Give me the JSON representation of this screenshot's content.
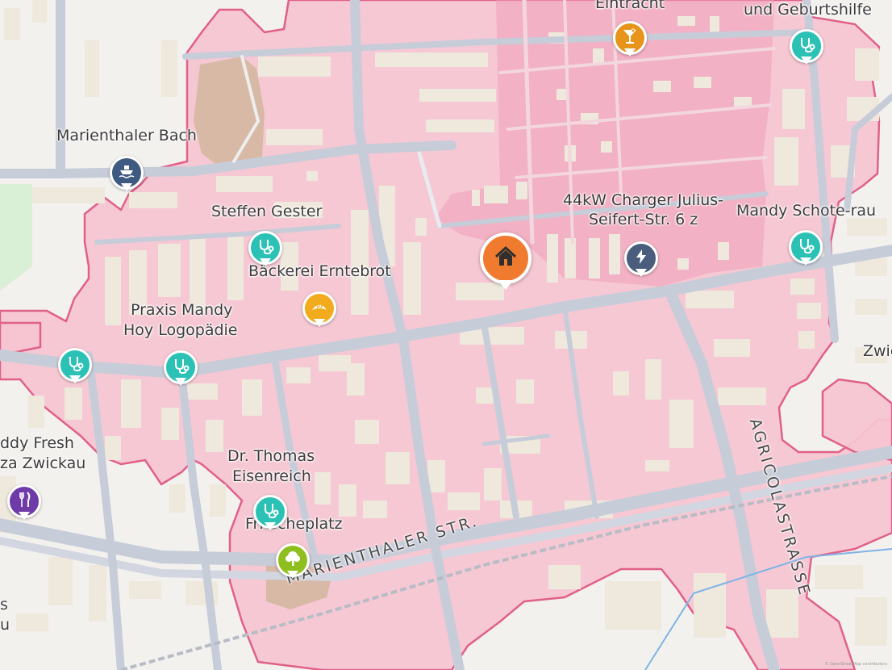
{
  "map": {
    "colors": {
      "zone_fill": "#f6c4d1",
      "zone_border": "#e0608a",
      "road": "#c7ccd9",
      "building": "#efe8dc",
      "background": "#f3f1ee",
      "park": "#d9efd6",
      "plaza": "#d7b9a6"
    },
    "labels": {
      "eintracht": "Eintracht",
      "geburtshilfe": "und Geburtshilfe",
      "marienthaler_bach": "Marienthaler Bach",
      "steffen_gester": "Steffen Gester",
      "baeckerei": "Bäckerei Erntebrot",
      "charger_line1": "44kW Charger Julius-",
      "charger_line2": "Seifert-Str. 6 z",
      "mandy_schote": "Mandy Schote-rau",
      "praxis_line1": "Praxis Mandy",
      "praxis_line2": "Hoy Logopädie",
      "zwi": "Zwic",
      "daddy_line1": "ddy Fresh",
      "daddy_line2": "za Zwickau",
      "thomas_line1": "Dr. Thomas",
      "thomas_line2": "Eisenreich",
      "fritscheplatz": "Fritscheplatz",
      "left_edge_1": "s",
      "left_edge_2": "u"
    },
    "streets": {
      "marienthaler": "MARIENTHALER STR.",
      "agricola": "AGRICOLASTRASSE"
    },
    "markers": [
      {
        "name": "bar",
        "icon": "cocktail-icon",
        "color": "#e8941a"
      },
      {
        "name": "geburtshilfe",
        "icon": "stethoscope-icon",
        "color": "#2bc1b5"
      },
      {
        "name": "marienthaler-bach",
        "icon": "boat-icon",
        "color": "#3e5a80"
      },
      {
        "name": "steffen-gester",
        "icon": "stethoscope-icon",
        "color": "#2bc1b5"
      },
      {
        "name": "baeckerei",
        "icon": "croissant-icon",
        "color": "#f3ab1e"
      },
      {
        "name": "charger",
        "icon": "lightning-icon",
        "color": "#4a5d7c"
      },
      {
        "name": "mandy-schote",
        "icon": "stethoscope-icon",
        "color": "#2bc1b5"
      },
      {
        "name": "praxis-left",
        "icon": "stethoscope-icon",
        "color": "#2bc1b5"
      },
      {
        "name": "praxis-mandy",
        "icon": "stethoscope-icon",
        "color": "#2bc1b5"
      },
      {
        "name": "restaurant",
        "icon": "fork-knife-icon",
        "color": "#6e3ba8"
      },
      {
        "name": "thomas-eisenreich",
        "icon": "stethoscope-icon",
        "color": "#2bc1b5"
      },
      {
        "name": "fritscheplatz",
        "icon": "tree-icon",
        "color": "#8fbf1e"
      },
      {
        "name": "home",
        "icon": "home-icon",
        "color": "#f07b2e"
      }
    ],
    "attribution": "© OpenStreetMap contributors"
  }
}
